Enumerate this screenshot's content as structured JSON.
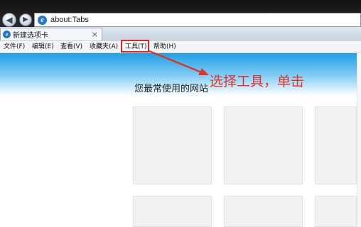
{
  "browser": {
    "address": "about:Tabs",
    "tab_title": "新建选项卡",
    "tab_close": "×",
    "back_glyph": "◀",
    "forward_glyph": "▶",
    "icon_name": "ie-logo-icon"
  },
  "menubar": {
    "items": [
      "文件(F)",
      "编辑(E)",
      "查看(V)",
      "收藏夹(A)",
      "工具(T)",
      "帮助(H)"
    ]
  },
  "content": {
    "section_title": "您最常使用的网站"
  },
  "annotation": {
    "text": "选择工具，单击",
    "color": "#e0342a"
  }
}
